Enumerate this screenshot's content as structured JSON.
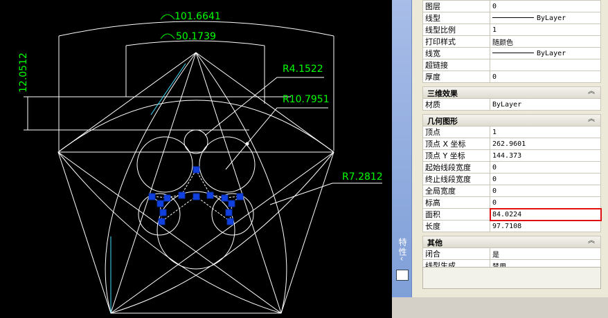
{
  "drawing": {
    "dims": {
      "arc_outer": "101.6641",
      "arc_inner": "50.1739",
      "vertical": "12.0512",
      "r_small": "R4.1522",
      "r_large": "R10.7951",
      "r_medium": "R7.2812"
    }
  },
  "panel": {
    "vertical_title": "特性",
    "general_rows": [
      {
        "key": "图层",
        "value": "0"
      },
      {
        "key": "线型",
        "value": "ByLayer",
        "linetype": true
      },
      {
        "key": "线型比例",
        "value": "1"
      },
      {
        "key": "打印样式",
        "value": "随颜色"
      },
      {
        "key": "线宽",
        "value": "ByLayer",
        "linetype": true
      },
      {
        "key": "超链接",
        "value": ""
      },
      {
        "key": "厚度",
        "value": "0"
      }
    ],
    "section_3d": {
      "title": "三维效果",
      "rows": [
        {
          "key": "材质",
          "value": "ByLayer"
        }
      ]
    },
    "section_geometry": {
      "title": "几何图形",
      "rows": [
        {
          "key": "顶点",
          "value": "1"
        },
        {
          "key": "顶点 X 坐标",
          "value": "262.9601"
        },
        {
          "key": "顶点 Y 坐标",
          "value": "144.373"
        },
        {
          "key": "起始线段宽度",
          "value": "0"
        },
        {
          "key": "终止线段宽度",
          "value": "0"
        },
        {
          "key": "全局宽度",
          "value": "0"
        },
        {
          "key": "标高",
          "value": "0"
        },
        {
          "key": "面积",
          "value": "84.0224",
          "highlight": true
        },
        {
          "key": "长度",
          "value": "97.7108"
        }
      ]
    },
    "section_misc": {
      "title": "其他",
      "rows": [
        {
          "key": "闭合",
          "value": "是"
        },
        {
          "key": "线型生成",
          "value": "禁用"
        }
      ]
    }
  }
}
